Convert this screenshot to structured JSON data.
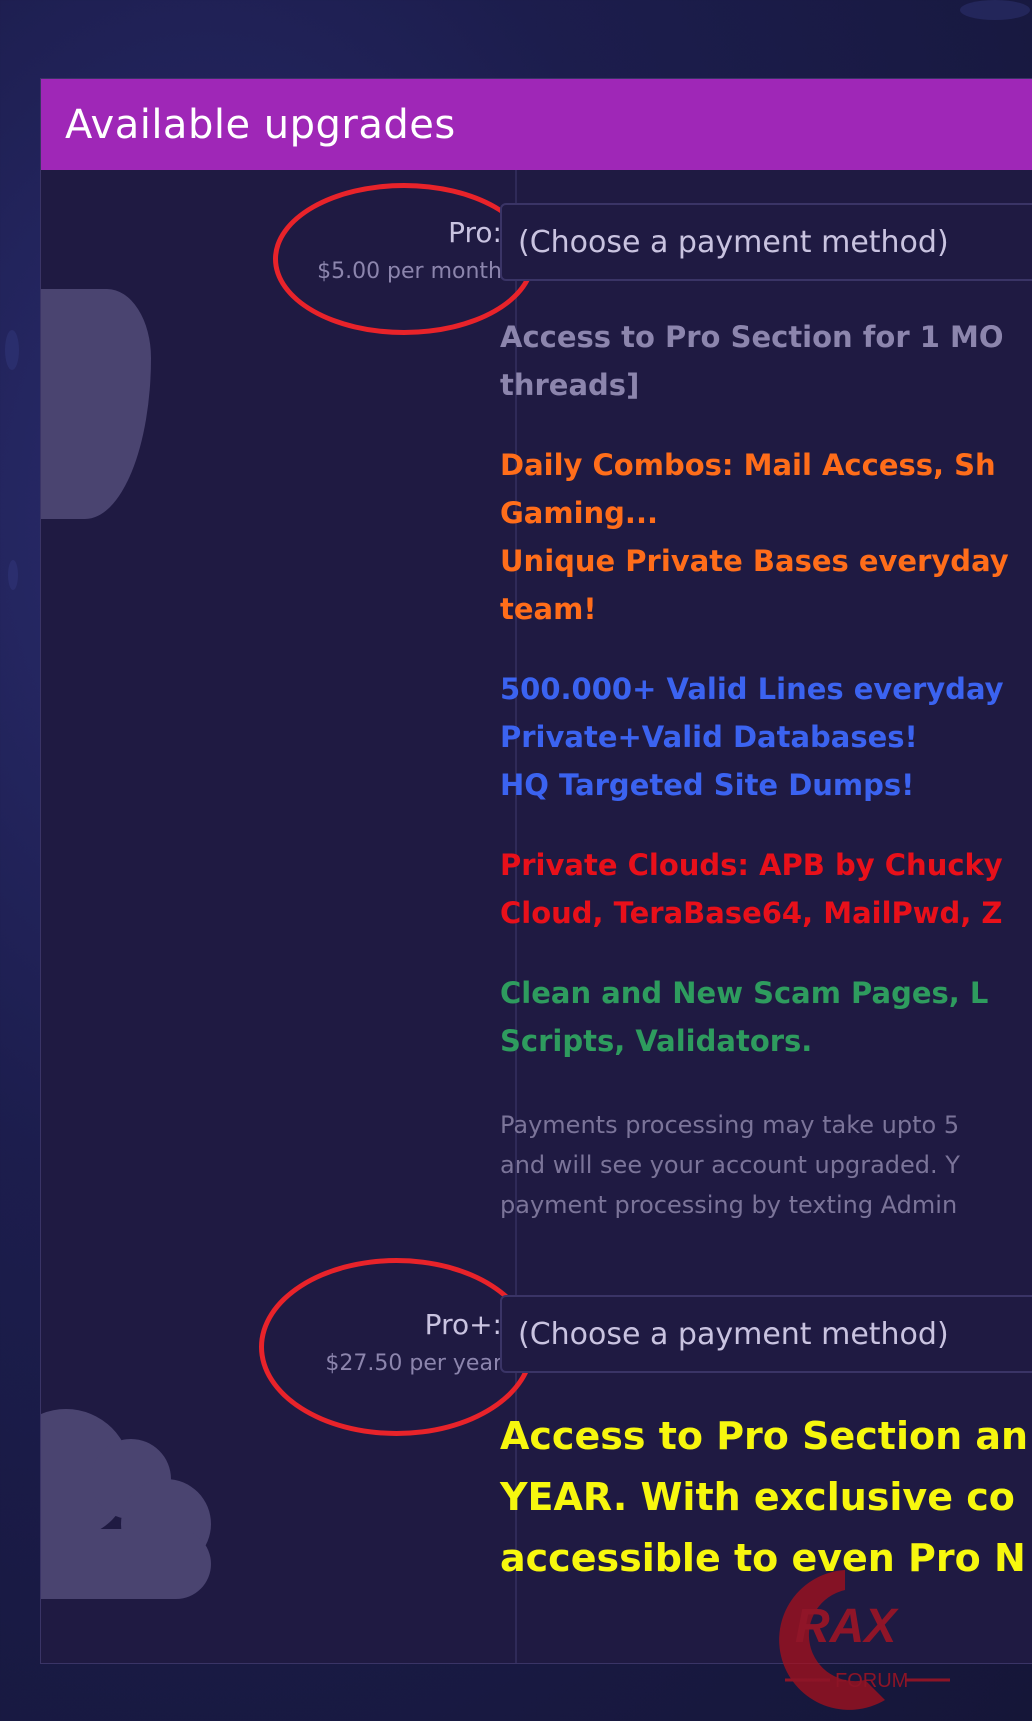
{
  "panel": {
    "title": "Available upgrades"
  },
  "colors": {
    "header": "#9f27b7",
    "panel_bg": "#1f1a42",
    "circle": "#e8232a"
  },
  "tiers": [
    {
      "name": "Pro:",
      "price": "$5.00 per month",
      "select_placeholder": "(Choose a payment method)",
      "desc_gray": [
        "Access to Pro Section for 1 MO",
        "threads]"
      ],
      "desc_orange": [
        "Daily Combos: Mail Access, Sh",
        "Gaming...",
        "Unique Private Bases everyday",
        "team!"
      ],
      "desc_blue": [
        "500.000+ Valid Lines everyday",
        "Private+Valid Databases!",
        "HQ Targeted Site Dumps!"
      ],
      "desc_red": [
        "Private Clouds: APB by Chucky",
        "Cloud, TeraBase64, MailPwd, Z"
      ],
      "desc_green": [
        "Clean and New Scam Pages, L",
        "Scripts, Validators."
      ],
      "note": [
        "Payments processing may take upto 5",
        "and will see your account upgraded. Y",
        "payment processing by texting Admin"
      ]
    },
    {
      "name": "Pro+:",
      "price": "$27.50 per year",
      "select_placeholder": "(Choose a payment method)",
      "desc_yellow": [
        "Access to Pro Section an",
        "YEAR. With exclusive co",
        "accessible to even Pro N"
      ]
    }
  ],
  "logo": {
    "text": "RAX",
    "subtext": "FORUM"
  }
}
